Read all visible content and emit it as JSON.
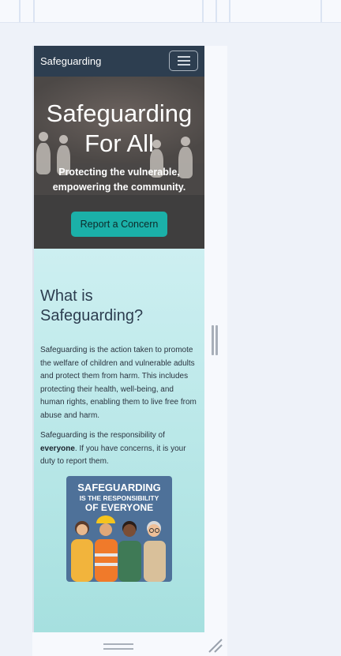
{
  "navbar": {
    "brand": "Safeguarding"
  },
  "hero": {
    "title_line1": "Safeguarding",
    "title_line2": "For All",
    "subtitle_line1": "Protecting the vulnerable,",
    "subtitle_line2": "empowering the community.",
    "cta_label": "Report a Concern"
  },
  "about": {
    "heading_line1": "What is",
    "heading_line2": "Safeguarding?",
    "paragraph1": "Safeguarding is the action taken to promote the welfare of children and vulnerable adults and protect them from harm. This includes protecting their health, well-being, and human rights, enabling them to live free from abuse and harm.",
    "paragraph2_before": "Safeguarding is the responsibility of ",
    "paragraph2_bold": "everyone",
    "paragraph2_after": ". If you have concerns, it is your duty to report them."
  },
  "poster": {
    "line1": "SAFEGUARDING",
    "line2": "IS THE RESPONSIBILITY",
    "line3": "OF EVERYONE"
  },
  "colors": {
    "navbar": "#2d3e50",
    "accent_button": "#1bb0a8",
    "content_bg_top": "#cdeff1",
    "content_bg_bottom": "#a6e0df",
    "heading": "#2d3e50"
  },
  "icons": [
    "hamburger-menu-icon",
    "resize-handle-icon",
    "splitter-handle-icon"
  ]
}
